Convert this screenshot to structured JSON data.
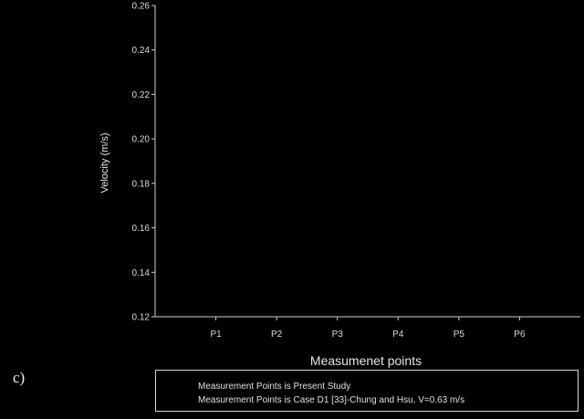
{
  "panel_label": "c)",
  "chart_data": {
    "type": "line",
    "categories": [
      "P1",
      "P2",
      "P3",
      "P4",
      "P5",
      "P6"
    ],
    "xlabel": "Measumenet points",
    "ylabel": "Velocity (m/s)",
    "ylim": [
      0.12,
      0.26
    ],
    "yticks": [
      "0.12",
      "0.14",
      "0.16",
      "0.18",
      "0.20",
      "0.22",
      "0.24",
      "0.26"
    ],
    "grid": false,
    "legend_position": "bottom",
    "series": [
      {
        "name": "Measurement Points is Present Study",
        "values": []
      },
      {
        "name": "Measurement Points is Case D1 [33]-Chung and Hsu, V=0.63  m/s",
        "values": []
      }
    ]
  },
  "colors": {
    "background": "#000000",
    "axis": "#d0d0d0",
    "text": "#e0e0e0"
  }
}
